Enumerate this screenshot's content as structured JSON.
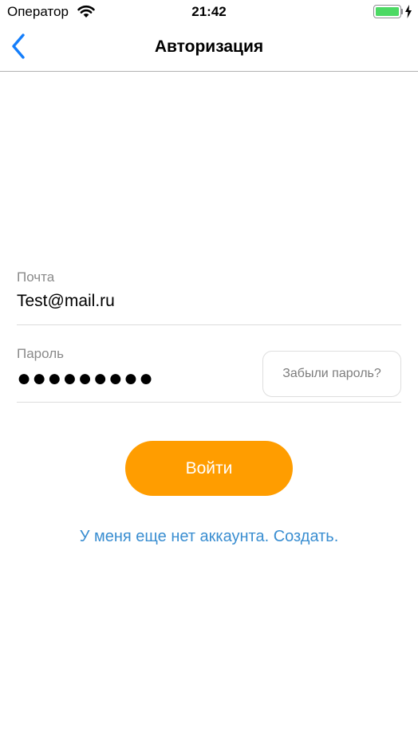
{
  "status_bar": {
    "carrier": "Оператор",
    "time": "21:42",
    "battery_level": 1.0
  },
  "nav": {
    "title": "Авторизация",
    "back_icon": "chevron-left-icon"
  },
  "form": {
    "email": {
      "label": "Почта",
      "value": "Test@mail.ru"
    },
    "password": {
      "label": "Пароль",
      "value": "●●●●●●●●●",
      "forgot_label": "Забыли пароль?"
    }
  },
  "actions": {
    "login_label": "Войти",
    "register_label": "У меня еще нет аккаунта. Создать."
  },
  "colors": {
    "accent_orange": "#ff9d00",
    "link_blue": "#3a8ed1",
    "ios_blue": "#147efb",
    "battery_green": "#4cd964"
  }
}
